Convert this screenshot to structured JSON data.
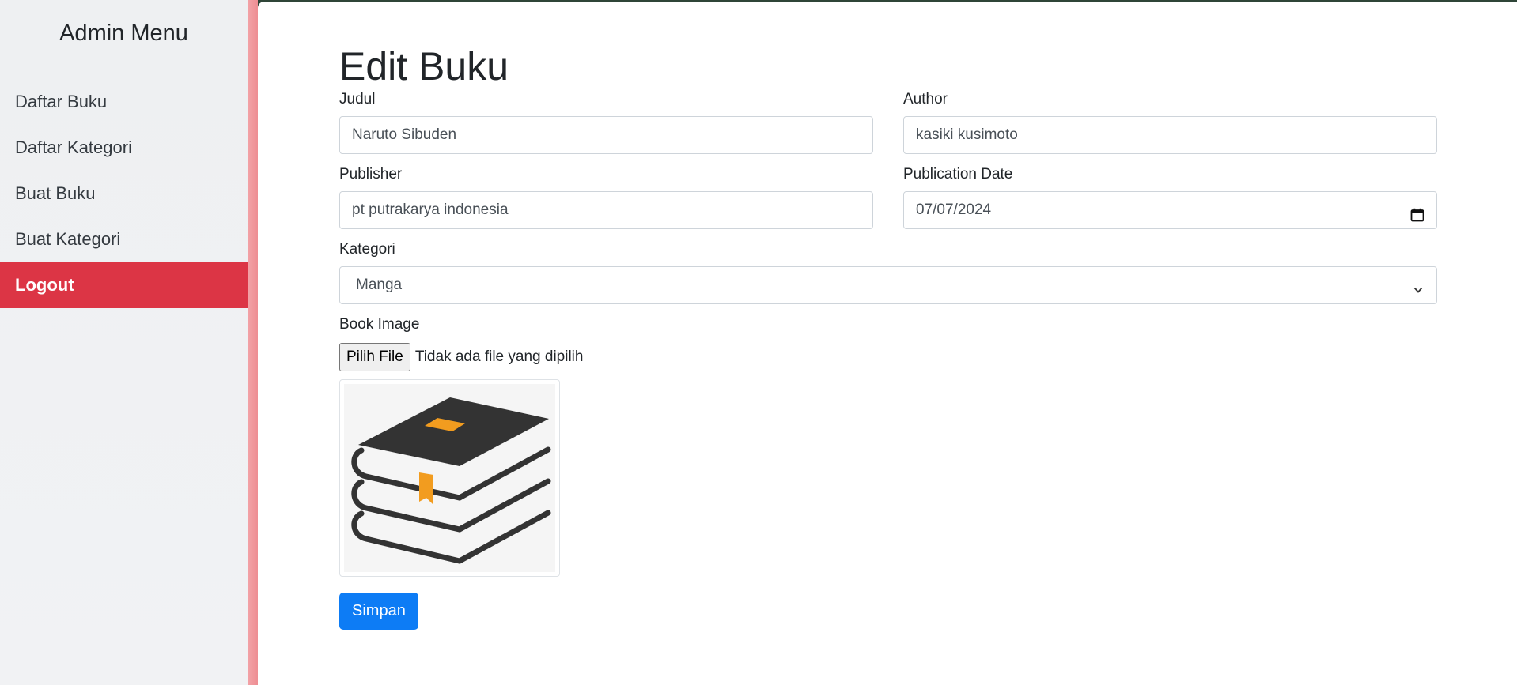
{
  "sidebar": {
    "title": "Admin Menu",
    "items": [
      {
        "label": "Daftar Buku"
      },
      {
        "label": "Daftar Kategori"
      },
      {
        "label": "Buat Buku"
      },
      {
        "label": "Buat Kategori"
      },
      {
        "label": "Logout"
      }
    ]
  },
  "form": {
    "title": "Edit Buku",
    "judul": {
      "label": "Judul",
      "value": "Naruto Sibuden"
    },
    "author": {
      "label": "Author",
      "value": "kasiki kusimoto"
    },
    "publisher": {
      "label": "Publisher",
      "value": "pt putrakarya indonesia"
    },
    "publication_date": {
      "label": "Publication Date",
      "value": "07/07/2024"
    },
    "kategori": {
      "label": "Kategori",
      "selected": "Manga"
    },
    "book_image": {
      "label": "Book Image",
      "button_label": "Pilih File",
      "file_status": "Tidak ada file yang dipilih",
      "icon": "books-stack-icon"
    },
    "submit_label": "Simpan"
  },
  "colors": {
    "logout": "#dc3545",
    "accent": "#ee8e93",
    "primary": "#0d7cf5",
    "book_dark": "#333333",
    "book_orange": "#f29c1f"
  }
}
